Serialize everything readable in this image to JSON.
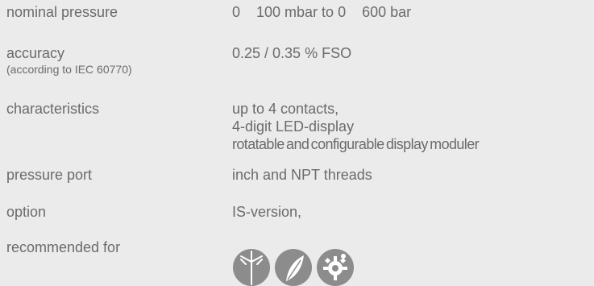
{
  "specs": {
    "nominal_pressure": {
      "label": "nominal pressure",
      "value_a": "0",
      "value_b": "100 mbar to 0",
      "value_c": "600 bar"
    },
    "accuracy": {
      "label": "accuracy",
      "sublabel": "(according to IEC 60770)",
      "value": "0.25 / 0.35 % FSO"
    },
    "characteristics": {
      "label": "characteristics",
      "values": [
        "up to 4 contacts,",
        "4-digit LED-display",
        "rotatable and configurable display moduler"
      ]
    },
    "pressure_port": {
      "label": "pressure port",
      "value": "inch and NPT threads"
    },
    "option": {
      "label": "option",
      "value": "IS-version,"
    },
    "recommended_for": {
      "label": "recommended for",
      "icons": [
        "wind-turbine-icon",
        "leaf-icon",
        "gear-icon"
      ]
    }
  }
}
